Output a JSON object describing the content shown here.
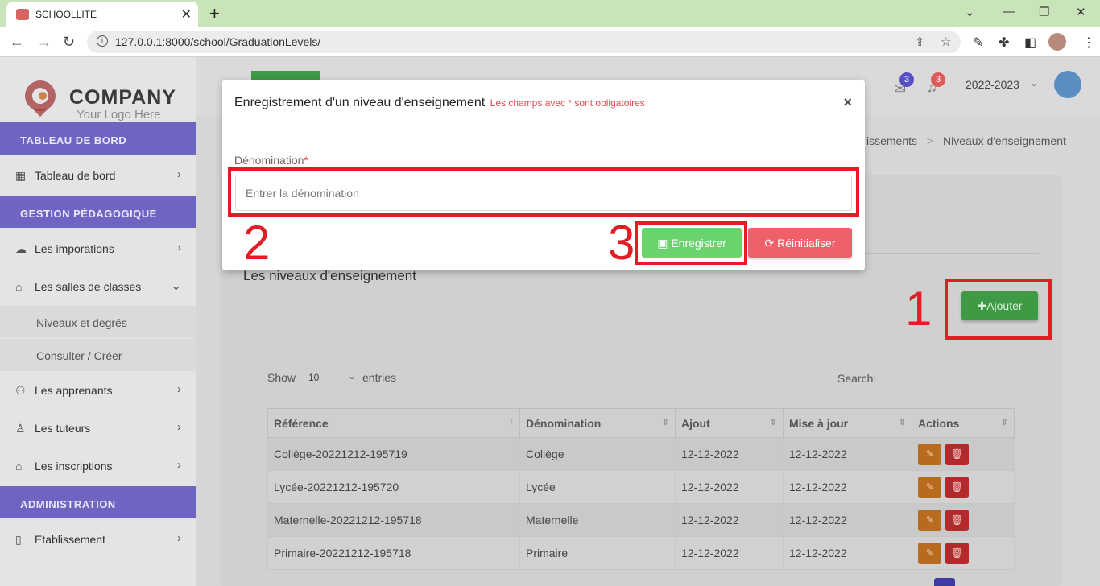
{
  "browser": {
    "tab_title": "SCHOOLLITE",
    "tab_close": "✕",
    "new_tab": "+",
    "url": "127.0.0.1:8000/school/GraduationLevels/",
    "info_icon": "i"
  },
  "brand": {
    "name": "COMPANY",
    "tagline": "Your Logo Here"
  },
  "sidebar": {
    "sections": [
      "TABLEAU DE BORD",
      "GESTION PÉDAGOGIQUE",
      "ADMINISTRATION"
    ],
    "items": [
      {
        "label": "Tableau de bord",
        "icon": "dashboard-icon"
      },
      {
        "label": "Les imporations",
        "icon": "cloud-icon"
      },
      {
        "label": "Les salles de classes",
        "icon": "home-icon"
      },
      {
        "label": "Les apprenants",
        "icon": "users-icon"
      },
      {
        "label": "Les tuteurs",
        "icon": "user-icon"
      },
      {
        "label": "Les inscriptions",
        "icon": "graduation-icon"
      },
      {
        "label": "Etablissement",
        "icon": "building-icon"
      }
    ],
    "subitems": [
      "Niveaux et degrés",
      "Consulter / Créer"
    ]
  },
  "header": {
    "mail_count": "3",
    "notif_count": "3",
    "school_year": "2022-2023"
  },
  "breadcrumb": {
    "parent": "issements",
    "separator": ">",
    "current": "Niveaux d'enseignement"
  },
  "content": {
    "title": "Les niveaux d'enseignement",
    "add_button": "Ajouter",
    "show_label": "Show",
    "show_value": "10",
    "entries_label": "entries",
    "search_label": "Search:",
    "columns": [
      "Référence",
      "Dénomination",
      "Ajout",
      "Mise à jour",
      "Actions"
    ],
    "rows": [
      {
        "ref": "Collège-20221212-195719",
        "name": "Collège",
        "added": "12-12-2022",
        "updated": "12-12-2022"
      },
      {
        "ref": "Lycée-20221212-195720",
        "name": "Lycée",
        "added": "12-12-2022",
        "updated": "12-12-2022"
      },
      {
        "ref": "Maternelle-20221212-195718",
        "name": "Maternelle",
        "added": "12-12-2022",
        "updated": "12-12-2022"
      },
      {
        "ref": "Primaire-20221212-195718",
        "name": "Primaire",
        "added": "12-12-2022",
        "updated": "12-12-2022"
      }
    ]
  },
  "modal": {
    "title": "Enregistrement d'un niveau d'enseignement",
    "required_note": "Les champs avec * sont obligatoires",
    "close": "×",
    "field_label": "Dénomination",
    "field_required": "*",
    "field_placeholder": "Entrer la dénomination",
    "field_value": "",
    "save_button": "Enregistrer",
    "reset_button": "Réinitialiser"
  },
  "annotations": [
    "1",
    "2",
    "3"
  ],
  "colors": {
    "sidebar_section": "#5a4ebd",
    "add_button": "#3f9a45",
    "save_button": "#6bd36e",
    "reset_button": "#f0606a",
    "annotation_red": "#e21d25"
  }
}
